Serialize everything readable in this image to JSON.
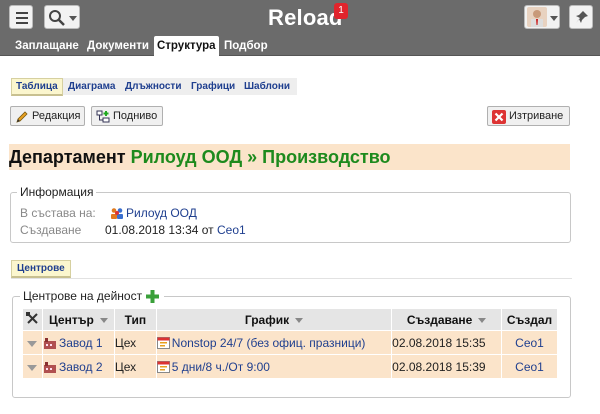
{
  "header": {
    "app_title": "Reload",
    "notification_count": "1",
    "icons": [
      "menu-icon",
      "search-icon",
      "user-avatar",
      "pin-icon"
    ]
  },
  "main_nav": {
    "items": [
      {
        "label": "Заплащане"
      },
      {
        "label": "Документи"
      },
      {
        "label": "Структура",
        "active": true
      },
      {
        "label": "Подбор"
      }
    ]
  },
  "sub_tabs": {
    "items": [
      {
        "label": "Таблица",
        "active": true
      },
      {
        "label": "Диаграма"
      },
      {
        "label": "Длъжности"
      },
      {
        "label": "Графици"
      },
      {
        "label": "Шаблони"
      }
    ]
  },
  "toolbar": {
    "edit_label": "Редакция",
    "sublevel_label": "Подниво",
    "delete_label": "Изтриване"
  },
  "page": {
    "prefix": "Департамент",
    "title": "Рилоуд ООД » Производство"
  },
  "info": {
    "legend": "Информация",
    "member_of_label": "В състава на:",
    "member_of_value": "Рилоуд ООД",
    "created_label": "Създаване",
    "created_value": "01.08.2018 13:34",
    "created_by_sep": "от",
    "created_by": "Ceo1"
  },
  "centres_tab": {
    "label": "Центрове"
  },
  "centres": {
    "legend": "Центрове на дейност",
    "columns": {
      "centre": "Център",
      "type": "Тип",
      "schedule": "График",
      "created": "Създаване",
      "created_by": "Създал"
    },
    "rows": [
      {
        "centre": "Завод 1",
        "type": "Цех",
        "schedule": "Nonstop 24/7 (без офиц. празници)",
        "created": "02.08.2018 15:35",
        "created_by": "Ceo1"
      },
      {
        "centre": "Завод 2",
        "type": "Цех",
        "schedule": "5 дни/8 ч./От 9:00",
        "created": "02.08.2018 15:39",
        "created_by": "Ceo1"
      }
    ]
  },
  "colors": {
    "header_bg": "#6b6b6b",
    "accent_green": "#1d8a1d",
    "link_blue": "#1f3f8f",
    "row_bg": "#fbe4ca",
    "badge_red": "#e0242c"
  }
}
